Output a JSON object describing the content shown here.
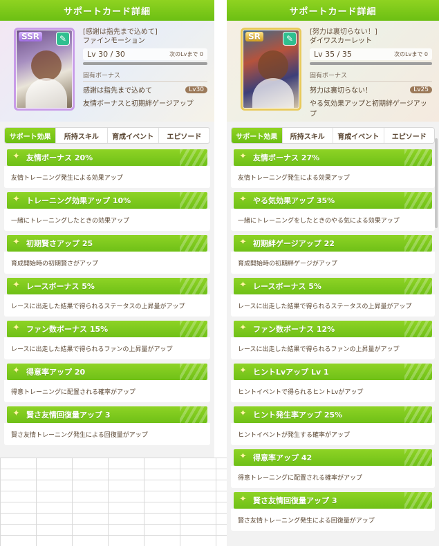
{
  "left": {
    "title": "サポートカード詳細",
    "rarity": "SSR",
    "card_title": "[感謝は指先まで込めて]",
    "card_name": "ファインモーション",
    "lv": "Lv 30 / 30",
    "lv_next": "次のLvまで 0",
    "bonus_head": "固有ボーナス",
    "bonus_name": "感謝は指先まで込めて",
    "bonus_lv": "Lv30",
    "bonus_desc": "友情ボーナスと初期絆ゲージアップ",
    "tabs": [
      "サポート効果",
      "所持スキル",
      "育成イベント",
      "エピソード"
    ],
    "effects": [
      {
        "name": "友情ボーナス 20%",
        "desc": "友情トレーニング発生による効果アップ"
      },
      {
        "name": "トレーニング効果アップ 10%",
        "desc": "一緒にトレーニングしたときの効果アップ"
      },
      {
        "name": "初期賢さアップ 25",
        "desc": "育成開始時の初期賢さがアップ"
      },
      {
        "name": "レースボーナス 5%",
        "desc": "レースに出走した結果で得られるステータスの上昇量がアップ"
      },
      {
        "name": "ファン数ボーナス 15%",
        "desc": "レースに出走した結果で得られるファンの上昇量がアップ"
      },
      {
        "name": "得意率アップ 20",
        "desc": "得意トレーニングに配置される確率がアップ"
      },
      {
        "name": "賢さ友情回復量アップ 3",
        "desc": "賢さ友情トレーニング発生による回復量がアップ"
      }
    ]
  },
  "right": {
    "title": "サポートカード詳細",
    "rarity": "SR",
    "card_title": "[努力は裏切らない！]",
    "card_name": "ダイワスカーレット",
    "lv": "Lv 35 / 35",
    "lv_next": "次のLvまで 0",
    "bonus_head": "固有ボーナス",
    "bonus_name": "努力は裏切らない！",
    "bonus_lv": "Lv25",
    "bonus_desc": "やる気効果アップと初期絆ゲージアップ",
    "tabs": [
      "サポート効果",
      "所持スキル",
      "育成イベント",
      "エピソード"
    ],
    "effects": [
      {
        "name": "友情ボーナス 27%",
        "desc": "友情トレーニング発生による効果アップ"
      },
      {
        "name": "やる気効果アップ 35%",
        "desc": "一緒にトレーニングをしたときのやる気による効果アップ"
      },
      {
        "name": "初期絆ゲージアップ 22",
        "desc": "育成開始時の初期絆ゲージがアップ"
      },
      {
        "name": "レースボーナス 5%",
        "desc": "レースに出走した結果で得られるステータスの上昇量がアップ"
      },
      {
        "name": "ファン数ボーナス 12%",
        "desc": "レースに出走した結果で得られるファンの上昇量がアップ"
      },
      {
        "name": "ヒントLvアップ Lv 1",
        "desc": "ヒントイベントで得られるヒントLvがアップ"
      },
      {
        "name": "ヒント発生率アップ 25%",
        "desc": "ヒントイベントが発生する確率がアップ"
      },
      {
        "name": "得意率アップ 42",
        "desc": "得意トレーニングに配置される確率がアップ"
      },
      {
        "name": "賢さ友情回復量アップ 3",
        "desc": "賢さ友情トレーニング発生による回復量がアップ"
      }
    ]
  }
}
